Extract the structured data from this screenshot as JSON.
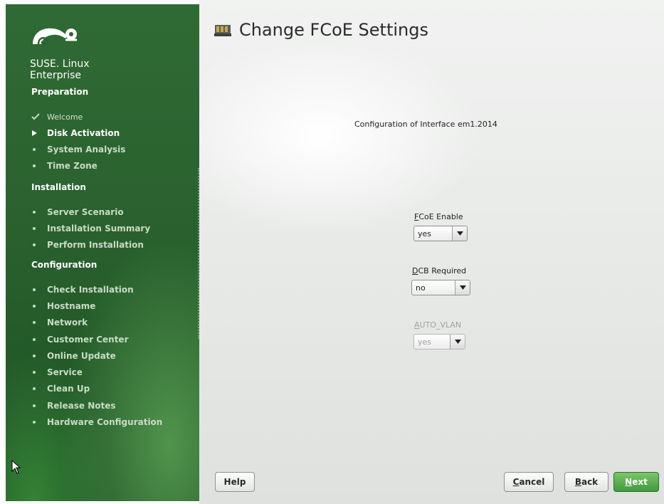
{
  "colors": {
    "sidebar_green": "#2c6330",
    "accent_green": "#3f9a3d",
    "main_bg": "#e7e9e7"
  },
  "brand": {
    "logo_icon": "suse-chameleon-logo",
    "line1": "SUSE. Linux",
    "line2": "Enterprise"
  },
  "sidebar": {
    "sections": [
      {
        "title": "Preparation",
        "steps": [
          {
            "label": "Welcome",
            "state": "done",
            "icon": "check-icon"
          },
          {
            "label": "Disk Activation",
            "state": "active",
            "icon": "triangle-right-icon"
          },
          {
            "label": "System Analysis",
            "state": "pending",
            "icon": "bullet-icon"
          },
          {
            "label": "Time Zone",
            "state": "pending",
            "icon": "bullet-icon"
          }
        ]
      },
      {
        "title": "Installation",
        "steps": [
          {
            "label": "Server Scenario",
            "state": "pending",
            "icon": "bullet-icon"
          },
          {
            "label": "Installation Summary",
            "state": "pending",
            "icon": "bullet-icon"
          },
          {
            "label": "Perform Installation",
            "state": "pending",
            "icon": "bullet-icon"
          }
        ]
      },
      {
        "title": "Configuration",
        "steps": [
          {
            "label": "Check Installation",
            "state": "pending",
            "icon": "bullet-icon"
          },
          {
            "label": "Hostname",
            "state": "pending",
            "icon": "bullet-icon"
          },
          {
            "label": "Network",
            "state": "pending",
            "icon": "bullet-icon"
          },
          {
            "label": "Customer Center",
            "state": "pending",
            "icon": "bullet-icon"
          },
          {
            "label": "Online Update",
            "state": "pending",
            "icon": "bullet-icon"
          },
          {
            "label": "Service",
            "state": "pending",
            "icon": "bullet-icon"
          },
          {
            "label": "Clean Up",
            "state": "pending",
            "icon": "bullet-icon"
          },
          {
            "label": "Release Notes",
            "state": "pending",
            "icon": "bullet-icon"
          },
          {
            "label": "Hardware Configuration",
            "state": "pending",
            "icon": "bullet-icon"
          }
        ]
      }
    ]
  },
  "main": {
    "title": "Change FCoE Settings",
    "title_icon": "network-card-icon",
    "interface_label": "Configuration of Interface em1.2014",
    "fields": {
      "fcoe_enable": {
        "mnemonic": "F",
        "rest": "CoE Enable",
        "value": "yes",
        "enabled": true
      },
      "dcb_required": {
        "mnemonic": "D",
        "rest": "CB Required",
        "value": "no",
        "enabled": true
      },
      "auto_vlan": {
        "mnemonic": "A",
        "rest": "UTO_VLAN",
        "value": "yes",
        "enabled": false
      }
    }
  },
  "buttons": {
    "help": "Help",
    "cancel": {
      "mnemonic": "C",
      "rest": "ancel"
    },
    "back": {
      "mnemonic": "B",
      "rest": "ack"
    },
    "next": {
      "mnemonic": "N",
      "rest": "ext"
    }
  }
}
